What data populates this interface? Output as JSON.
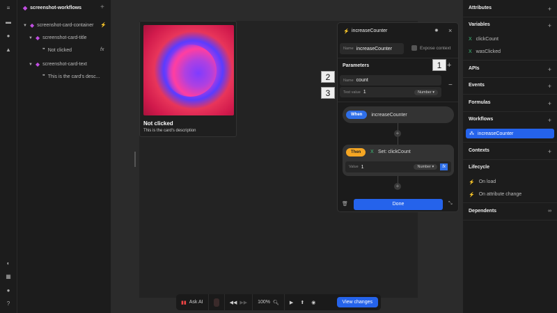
{
  "left_rail": {
    "icons": [
      "layers-icon",
      "folder-icon",
      "globe-icon",
      "warning-icon",
      "palette-icon",
      "grid-icon",
      "bulb-icon",
      "help-icon"
    ]
  },
  "tree": {
    "title": "screenshot-workflows",
    "items": [
      {
        "label": "screenshot-card-container"
      },
      {
        "label": "screenshot-card-title"
      },
      {
        "label": "Not clicked"
      },
      {
        "label": "screenshot-card-text"
      },
      {
        "label": "This is the card's desc..."
      }
    ]
  },
  "card": {
    "title": "Not clicked",
    "description": "This is the card's description"
  },
  "panel": {
    "title": "increaseCounter",
    "name_label": "Name",
    "name_value": "increaseCounter",
    "expose_label": "Expose context",
    "parameters_label": "Parameters",
    "param": {
      "name_label": "Name",
      "name_value": "count",
      "test_label": "Test value",
      "test_value": "1",
      "type": "Number ▾"
    },
    "when_label": "When",
    "when_value": "increaseCounter",
    "then_label": "Then",
    "then_action": "Set: clickCount",
    "value_label": "Value",
    "value": "1",
    "value_type": "Number ▾",
    "fx": "fx",
    "done": "Done"
  },
  "callouts": [
    "1",
    "2",
    "3"
  ],
  "right": {
    "attributes": "Attributes",
    "variables": "Variables",
    "vars": [
      "clickCount",
      "wasClicked"
    ],
    "apis": "APIs",
    "events": "Events",
    "formulas": "Formulas",
    "workflows": "Workflows",
    "workflow_items": [
      "increaseCounter"
    ],
    "contexts": "Contexts",
    "lifecycle": "Lifecycle",
    "lifecycle_items": [
      "On load",
      "On attribute change"
    ],
    "dependents": "Dependents"
  },
  "toolbar": {
    "ask_ai": "Ask AI",
    "zoom": "100%",
    "view_changes": "View changes"
  },
  "colors": {
    "accent": "#2563eb",
    "then": "#f5a623",
    "diamond": "#c04ee0"
  }
}
